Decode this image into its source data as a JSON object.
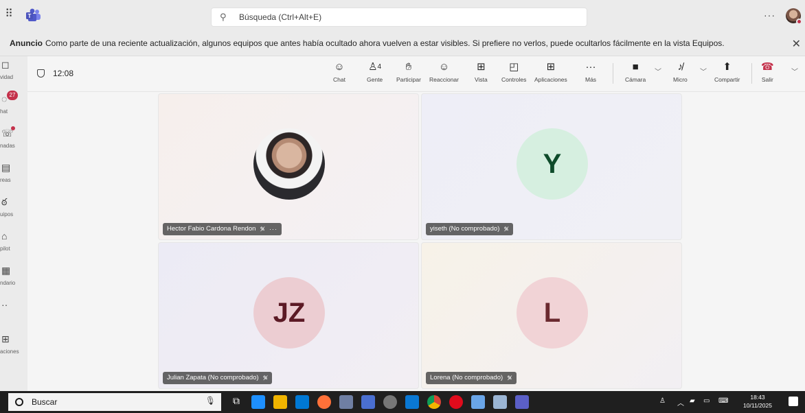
{
  "titlebar": {
    "search_placeholder": "Búsqueda (Ctrl+Alt+E)",
    "more": "···"
  },
  "announcement": {
    "label": "Anuncio",
    "text": "Como parte de una reciente actualización, algunos equipos que antes había ocultado ahora vuelven a estar visibles. Si prefiere no verlos, puede ocultarlos fácilmente en la vista Equipos.",
    "close": "✕"
  },
  "rail": {
    "items": [
      {
        "label": "vidad",
        "icon": "bell-icon"
      },
      {
        "label": "hat",
        "icon": "chat-icon",
        "badge": "27"
      },
      {
        "label": "nadas",
        "icon": "phone-icon"
      },
      {
        "label": "reas",
        "icon": "tasks-icon"
      },
      {
        "label": "uipos",
        "icon": "teams-icon"
      },
      {
        "label": "pilot",
        "icon": "copilot-icon"
      },
      {
        "label": "ndario",
        "icon": "calendar-icon"
      },
      {
        "label": "",
        "icon": "more-icon"
      },
      {
        "label": "aciones",
        "icon": "apps-icon"
      }
    ]
  },
  "meeting": {
    "time": "12:08",
    "participants_count": "4",
    "toolbar": {
      "chat": "Chat",
      "people": "Gente",
      "raise": "Participar",
      "react": "Reaccionar",
      "view": "Vista",
      "controls": "Controles",
      "apps": "Aplicaciones",
      "more": "Más",
      "camera": "Cámara",
      "mic": "Micro",
      "share": "Compartir",
      "leave": "Salir"
    }
  },
  "participants": [
    {
      "name": "Hector Fabio Cardona Rendon",
      "initials": ""
    },
    {
      "name": "yiseth (No comprobado)",
      "initials": "Y"
    },
    {
      "name": "Julian Zapata (No comprobado)",
      "initials": "JZ"
    },
    {
      "name": "Lorena (No comprobado)",
      "initials": "L"
    }
  ],
  "taskbar": {
    "search_label": "Buscar",
    "time": "18:43",
    "date": "10/11/2025"
  },
  "colors": {
    "accent": "#5b5fc7",
    "leave_red": "#c4314b",
    "y_bg": "#d6efe0",
    "y_fg": "#0e4b2a",
    "jz_bg": "#eccdd2",
    "jz_fg": "#5c1a25",
    "l_bg": "#f1d3d6",
    "l_fg": "#6b2a30"
  }
}
